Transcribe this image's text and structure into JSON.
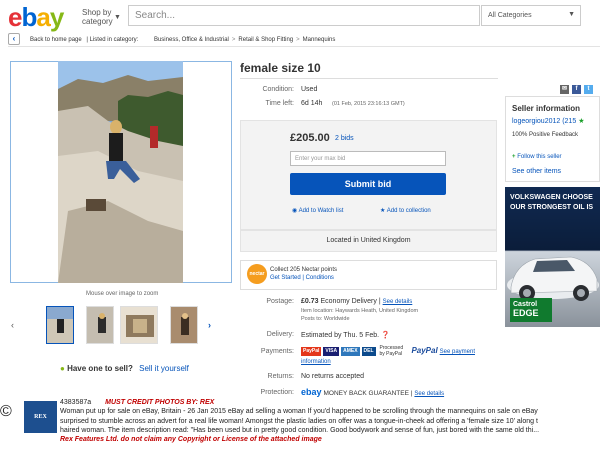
{
  "header": {
    "logo": {
      "e": "e",
      "b": "b",
      "a": "a",
      "y": "y"
    },
    "shop_by_line1": "Shop by",
    "shop_by_line2": "category",
    "search_placeholder": "Search...",
    "categories": "All Categories"
  },
  "breadcrumb": {
    "back": "Back to home page",
    "listed": "| Listed in category:",
    "items": [
      "Business, Office & Industrial",
      "Retail & Shop Fitting",
      "Mannequins"
    ]
  },
  "gallery": {
    "mouseover": "Mouse over image to zoom"
  },
  "sell_prompt": {
    "question": "Have one to sell?",
    "link": "Sell it yourself"
  },
  "listing": {
    "title": "female size 10",
    "condition_label": "Condition:",
    "condition_value": "Used",
    "time_label": "Time left:",
    "time_value": "6d 14h",
    "time_end": "(01 Feb, 2015  23:16:13 GMT)",
    "price": "£205.00",
    "bids": "2 bids",
    "max_bid_placeholder": "Enter your max bid",
    "submit": "Submit bid",
    "watch": "Add to Watch list",
    "collection": "Add to collection",
    "located": "Located in United Kingdom"
  },
  "nectar": {
    "logo": "nectar",
    "line1": "Collect 205 Nectar points",
    "line2a": "Get Started",
    "line2b": "| Conditions"
  },
  "postage": {
    "label": "Postage:",
    "price": "£0.73",
    "service": "Economy Delivery |",
    "see": "See details",
    "item_location": "Item location:  Haywards Heath, United Kingdom",
    "posts_to": "Posts to:  Worldwide"
  },
  "delivery": {
    "label": "Delivery:",
    "value": "Estimated by Thu. 5 Feb."
  },
  "payments": {
    "label": "Payments:",
    "badges": [
      "PayPal",
      "VISA",
      "AMEX",
      "DEL"
    ],
    "processed": "Processed by PayPal",
    "paypal": "PayPal",
    "see": "See payment",
    "information": "information"
  },
  "returns": {
    "label": "Returns:",
    "value": "No returns accepted"
  },
  "protection": {
    "label": "Protection:",
    "ebay": "ebay",
    "guarantee": "MONEY BACK GUARANTEE |",
    "see": "See details"
  },
  "seller": {
    "heading": "Seller information",
    "name": "logeorgiou2012 (215",
    "positive": "100% Positive Feedback",
    "follow": "Follow this seller",
    "other": "See other items"
  },
  "ad": {
    "line1": "VOLKSWAGEN CHOOSE",
    "line2": "OUR STRONGEST OIL IS",
    "brand": "Castrol",
    "product": "EDGE"
  },
  "caption": {
    "copyright": "©",
    "rex": "REX",
    "id": "4383587a",
    "credit": "MUST CREDIT PHOTOS BY: REX",
    "line2": "Woman put up for sale on eBay, Britain - 26 Jan 2015 eBay ad selling a woman If you'd happened to be scrolling through the mannequins on sale on eBay",
    "line3": "surprised to stumble across an advert for a real life woman! Amongst the plastic ladies on offer was a tongue-in-cheek ad offering a 'female size 10' along t",
    "line4": "haired woman. The item description read: \"Has been used but in pretty good condition. Good bodywork and sense of fun, just bored with the same old thi...",
    "line5": "Rex Features Ltd. do not claim any Copyright or License of the attached image"
  }
}
